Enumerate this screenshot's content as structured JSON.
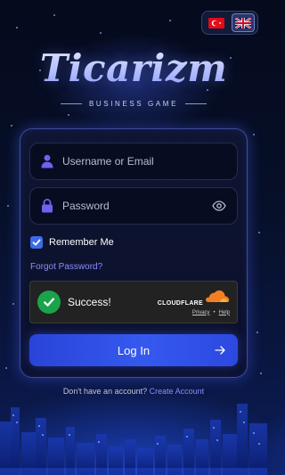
{
  "language": {
    "options": [
      {
        "code": "tr",
        "icon": "turkey-flag-icon",
        "selected": false
      },
      {
        "code": "en",
        "icon": "uk-flag-icon",
        "selected": true
      }
    ]
  },
  "brand": {
    "title": "Ticarizm",
    "subtitle": "BUSINESS GAME"
  },
  "form": {
    "username": {
      "placeholder": "Username or Email",
      "value": "",
      "icon": "user-icon"
    },
    "password": {
      "placeholder": "Password",
      "value": "",
      "icon": "lock-icon",
      "toggle_icon": "eye-icon"
    },
    "remember": {
      "label": "Remember Me",
      "checked": true
    },
    "forgot_label": "Forgot Password?",
    "submit_label": "Log In"
  },
  "captcha": {
    "status": "Success!",
    "provider": "CLOUDFLARE",
    "links": [
      "Privacy",
      "Help"
    ]
  },
  "footer": {
    "prompt": "Don't have an account?",
    "link": "Create Account"
  },
  "colors": {
    "accent": "#3559ef",
    "link": "#8a8dff",
    "success": "#1aa34a",
    "cloudflare": "#f38020"
  }
}
